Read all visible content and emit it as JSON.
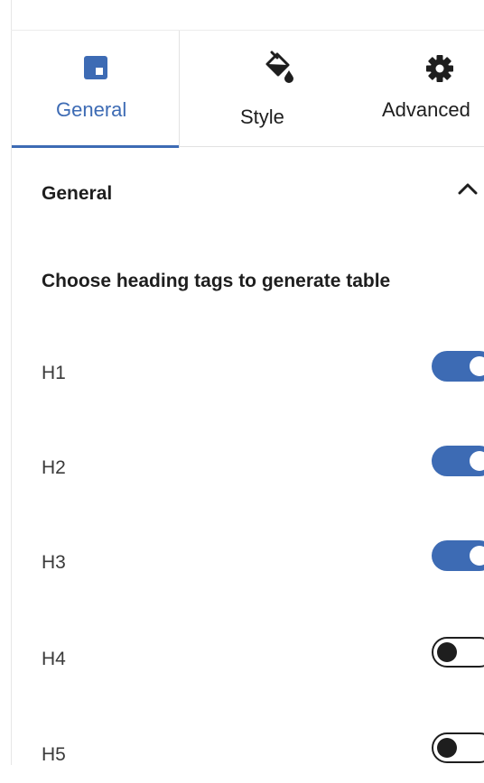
{
  "tabs": [
    {
      "label": "General",
      "icon": "block-layout-icon",
      "active": true
    },
    {
      "label": "Style",
      "icon": "paint-bucket-icon",
      "active": false
    },
    {
      "label": "Advanced",
      "icon": "gear-icon",
      "active": false
    }
  ],
  "panel": {
    "title": "General",
    "expanded": true
  },
  "headings": {
    "label": "Choose heading tags to generate table",
    "items": [
      {
        "label": "H1",
        "enabled": true
      },
      {
        "label": "H2",
        "enabled": true
      },
      {
        "label": "H3",
        "enabled": true
      },
      {
        "label": "H4",
        "enabled": false
      },
      {
        "label": "H5",
        "enabled": false
      }
    ]
  },
  "colors": {
    "accent": "#3d6bb4",
    "text": "#1e1e1e"
  }
}
